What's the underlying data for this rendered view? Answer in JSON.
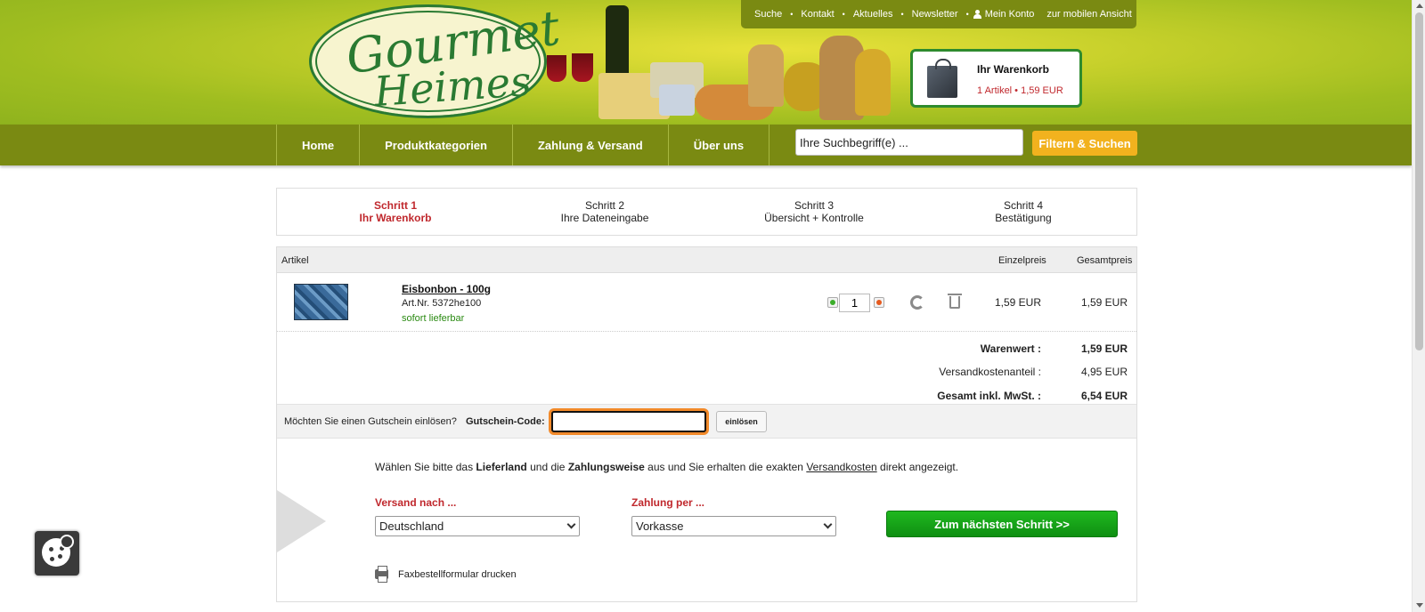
{
  "header": {
    "logo_line1": "Gourmet",
    "logo_line2": "Heimes",
    "top_links": [
      "Suche",
      "Kontakt",
      "Aktuelles",
      "Newsletter",
      "Mein Konto",
      "zur mobilen Ansicht"
    ],
    "cart": {
      "title": "Ihr Warenkorb",
      "info": "1 Artikel  •  1,59 EUR"
    }
  },
  "mainnav": {
    "items": [
      "Home",
      "Produktkategorien",
      "Zahlung & Versand",
      "Über uns"
    ],
    "search_value": "Ihre Suchbegriff(e) ...",
    "search_button": "Filtern & Suchen"
  },
  "steps": [
    {
      "num": "Schritt 1",
      "label": "Ihr Warenkorb"
    },
    {
      "num": "Schritt 2",
      "label": "Ihre Dateneingabe"
    },
    {
      "num": "Schritt 3",
      "label": "Übersicht + Kontrolle"
    },
    {
      "num": "Schritt 4",
      "label": "Bestätigung"
    }
  ],
  "cart_table": {
    "headers": {
      "article": "Artikel",
      "unit_price": "Einzelpreis",
      "total_price": "Gesamtpreis"
    },
    "item": {
      "name": "Eisbonbon - 100g",
      "article_no": "Art.Nr. 5372he100",
      "availability": "sofort lieferbar",
      "quantity": "1",
      "unit_price": "1,59 EUR",
      "total_price": "1,59 EUR"
    },
    "totals": {
      "goods_label": "Warenwert :",
      "goods_value": "1,59 EUR",
      "shipping_label": "Versandkostenanteil :",
      "shipping_value": "4,95 EUR",
      "total_label": "Gesamt inkl. MwSt. :",
      "total_value": "6,54 EUR"
    },
    "voucher": {
      "question": "Möchten Sie einen Gutschein einlösen?",
      "label": "Gutschein-Code:",
      "value": "",
      "button": "einlösen"
    }
  },
  "checkout": {
    "info_pre": "Wählen Sie bitte das ",
    "info_b1": "Lieferland",
    "info_mid1": " und die ",
    "info_b2": "Zahlungsweise",
    "info_mid2": " aus und Sie erhalten die exakten ",
    "info_link": "Versandkosten",
    "info_post": " direkt angezeigt.",
    "ship_label": "Versand nach ...",
    "ship_value": "Deutschland",
    "pay_label": "Zahlung per ...",
    "pay_value": "Vorkasse",
    "next_button": "Zum nächsten Schritt >>",
    "fax_link": "Faxbestellformular drucken"
  },
  "colors": {
    "brand_green": "#7a8a12",
    "accent_red": "#c0282d",
    "button_green": "#0f8f12",
    "search_orange": "#f2b21e"
  }
}
